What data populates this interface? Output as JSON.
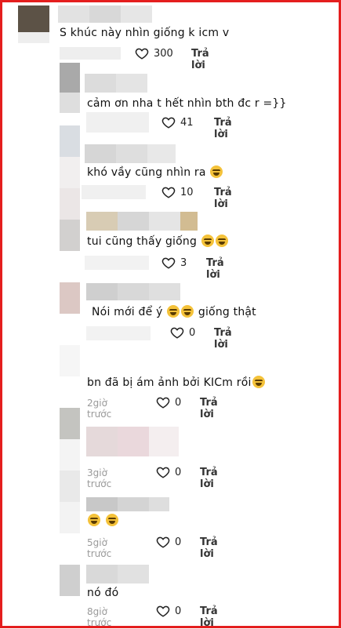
{
  "reply_label": "Trả lời",
  "comments": [
    {
      "text": "S khúc này nhìn giống k icm v",
      "likes": "300"
    },
    {
      "text": "cảm ơn nha t hết nhìn bth đc r =}}",
      "likes": "41"
    },
    {
      "text": "khó vầy cũng nhìn ra",
      "likes": "10"
    },
    {
      "text": "tui cũng thấy giống",
      "likes": "3"
    },
    {
      "text_a": "Nói mới để ý",
      "text_b": "giống thật",
      "likes": "0"
    },
    {
      "text": "bn đã bị ám ảnh bởi KICm rồi",
      "time": "2giờ trước",
      "likes": "0"
    },
    {
      "time": "3giờ trước",
      "likes": "0"
    },
    {
      "time": "5giờ trước",
      "likes": "0"
    },
    {
      "text": "nó đó",
      "time": "8giờ trước",
      "likes": "0"
    }
  ],
  "icons": {
    "like": "heart-icon",
    "emoji": "laughing-emoji"
  }
}
